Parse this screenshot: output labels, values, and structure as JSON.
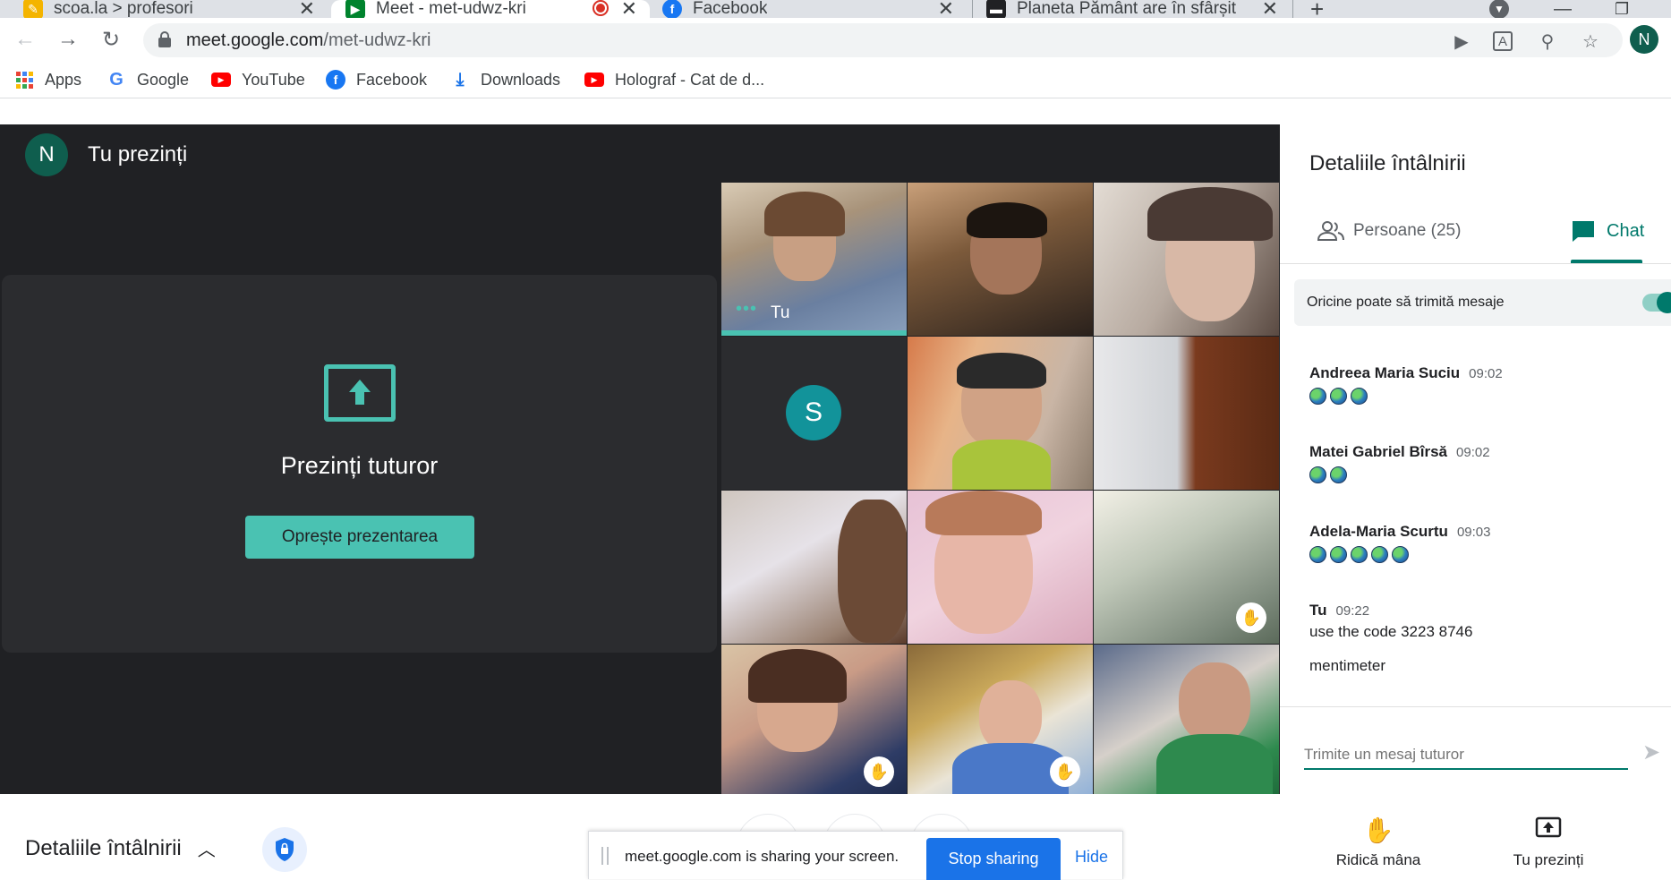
{
  "browser": {
    "tabs": [
      {
        "title": "scoa.la > profesori"
      },
      {
        "title": "Meet - met-udwz-kri"
      },
      {
        "title": "Facebook"
      },
      {
        "title": "Planeta Pământ are în sfârșit un s"
      }
    ],
    "new_tab": "+",
    "url_host": "meet.google.com",
    "url_path": "/met-udwz-kri",
    "profile_initial": "N",
    "bookmarks": [
      {
        "label": "Apps"
      },
      {
        "label": "Google"
      },
      {
        "label": "YouTube"
      },
      {
        "label": "Facebook"
      },
      {
        "label": "Downloads"
      },
      {
        "label": "Holograf - Cat de d..."
      }
    ]
  },
  "meet": {
    "presenter_initial": "N",
    "presenting_title": "Tu prezinți",
    "present_card_title": "Prezinți tuturor",
    "stop_presenting": "Oprește prezentarea",
    "self_label": "Tu",
    "speaking_dots": "•••",
    "s_tile_initial": "S",
    "colors": {
      "accent": "#4ac2b2",
      "stage": "#202124",
      "chat_green": "#00796b"
    }
  },
  "panel": {
    "title": "Detaliile întâlnirii",
    "people_tab": "Persoane (25)",
    "chat_tab": "Chat",
    "permission": "Oricine poate să trimită mesaje",
    "messages": [
      {
        "sender": "Andreea Maria Suciu",
        "time": "09:02",
        "globes": 3
      },
      {
        "sender": "Matei Gabriel Bîrsă",
        "time": "09:02",
        "globes": 2
      },
      {
        "sender": "Adela-Maria Scurtu",
        "time": "09:03",
        "globes": 5
      },
      {
        "sender": "Tu",
        "time": "09:22",
        "line1": "use the code 3223 8746",
        "line2": "mentimeter"
      }
    ],
    "input_placeholder": "Trimite un mesaj tuturor"
  },
  "bottom": {
    "details": "Detaliile întâlnirii",
    "raise_hand": "Ridică mâna",
    "you_present": "Tu prezinți"
  },
  "sharebar": {
    "message": "meet.google.com is sharing your screen.",
    "stop": "Stop sharing",
    "hide": "Hide"
  }
}
